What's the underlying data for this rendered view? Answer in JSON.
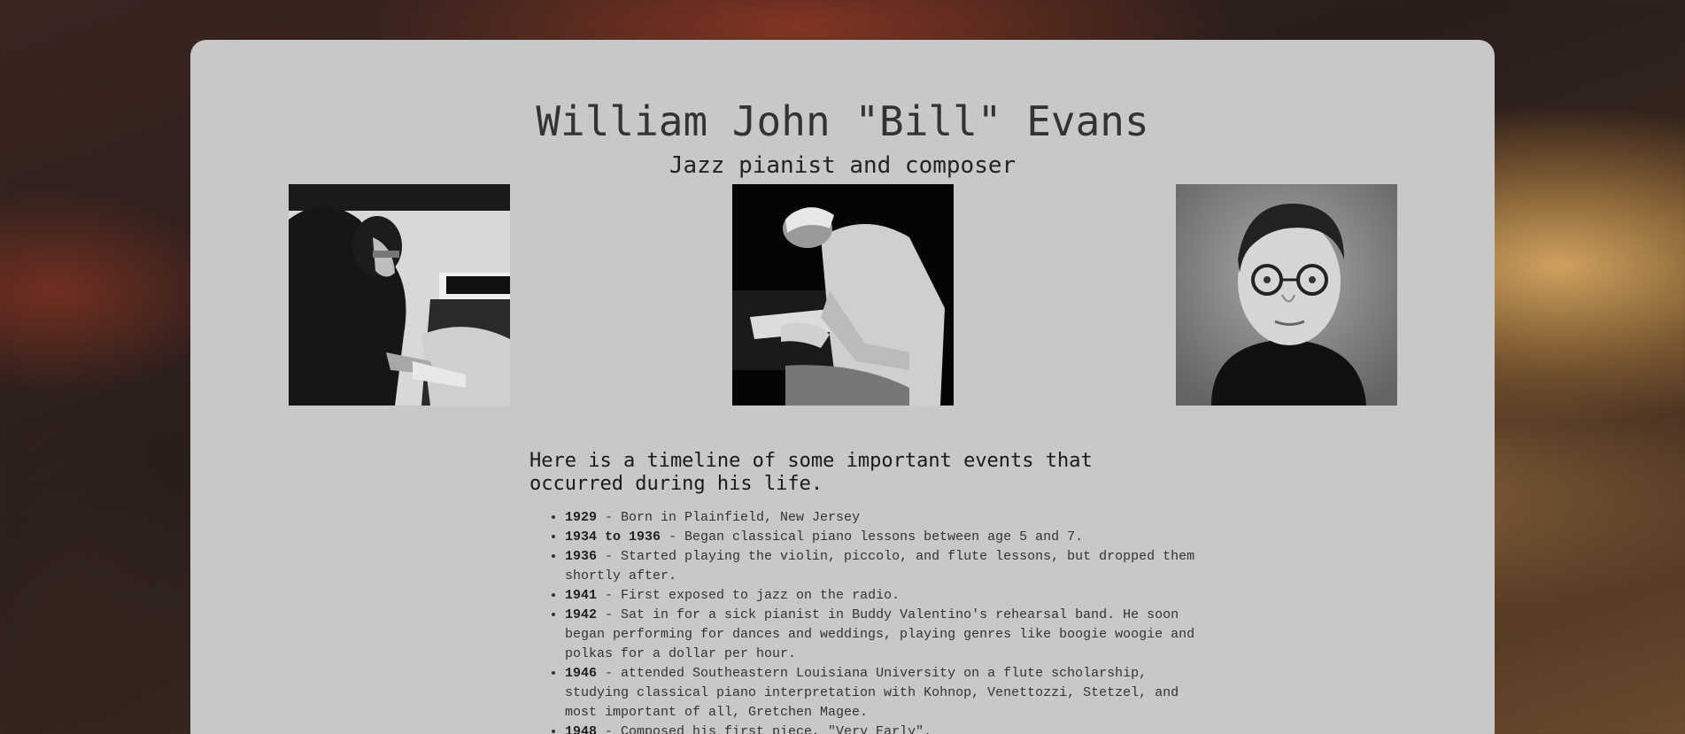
{
  "header": {
    "title": "William John \"Bill\" Evans",
    "subtitle": "Jazz pianist and composer"
  },
  "photos": [
    {
      "icon": "photo-evans-at-piano-profile"
    },
    {
      "icon": "photo-evans-playing-piano"
    },
    {
      "icon": "photo-evans-as-child"
    }
  ],
  "intro": "Here is a timeline of some important events that occurred during his life.",
  "timeline": [
    {
      "year": "1929",
      "text": " - Born in Plainfield, New Jersey"
    },
    {
      "year": "1934 to 1936",
      "text": " - Began classical piano lessons between age 5 and 7."
    },
    {
      "year": "1936",
      "text": " - Started playing the violin, piccolo, and flute lessons, but dropped them shortly after."
    },
    {
      "year": "1941",
      "text": " - First exposed to jazz on the radio."
    },
    {
      "year": "1942",
      "text": " - Sat in for a sick pianist in Buddy Valentino's rehearsal band. He soon began performing for dances and weddings, playing genres like boogie woogie and polkas for a dollar per hour."
    },
    {
      "year": "1946",
      "text": " - attended Southeastern Louisiana University on a flute scholarship, studying classical piano interpretation with Kohnop, Venettozzi, Stetzel, and most important of all, Gretchen Magee."
    },
    {
      "year": "1948",
      "text": " - Composed his first piece, \"Very Early\"."
    }
  ],
  "colors": {
    "card_bg": "#c8c8c8",
    "title": "#333333",
    "text": "#333333"
  }
}
